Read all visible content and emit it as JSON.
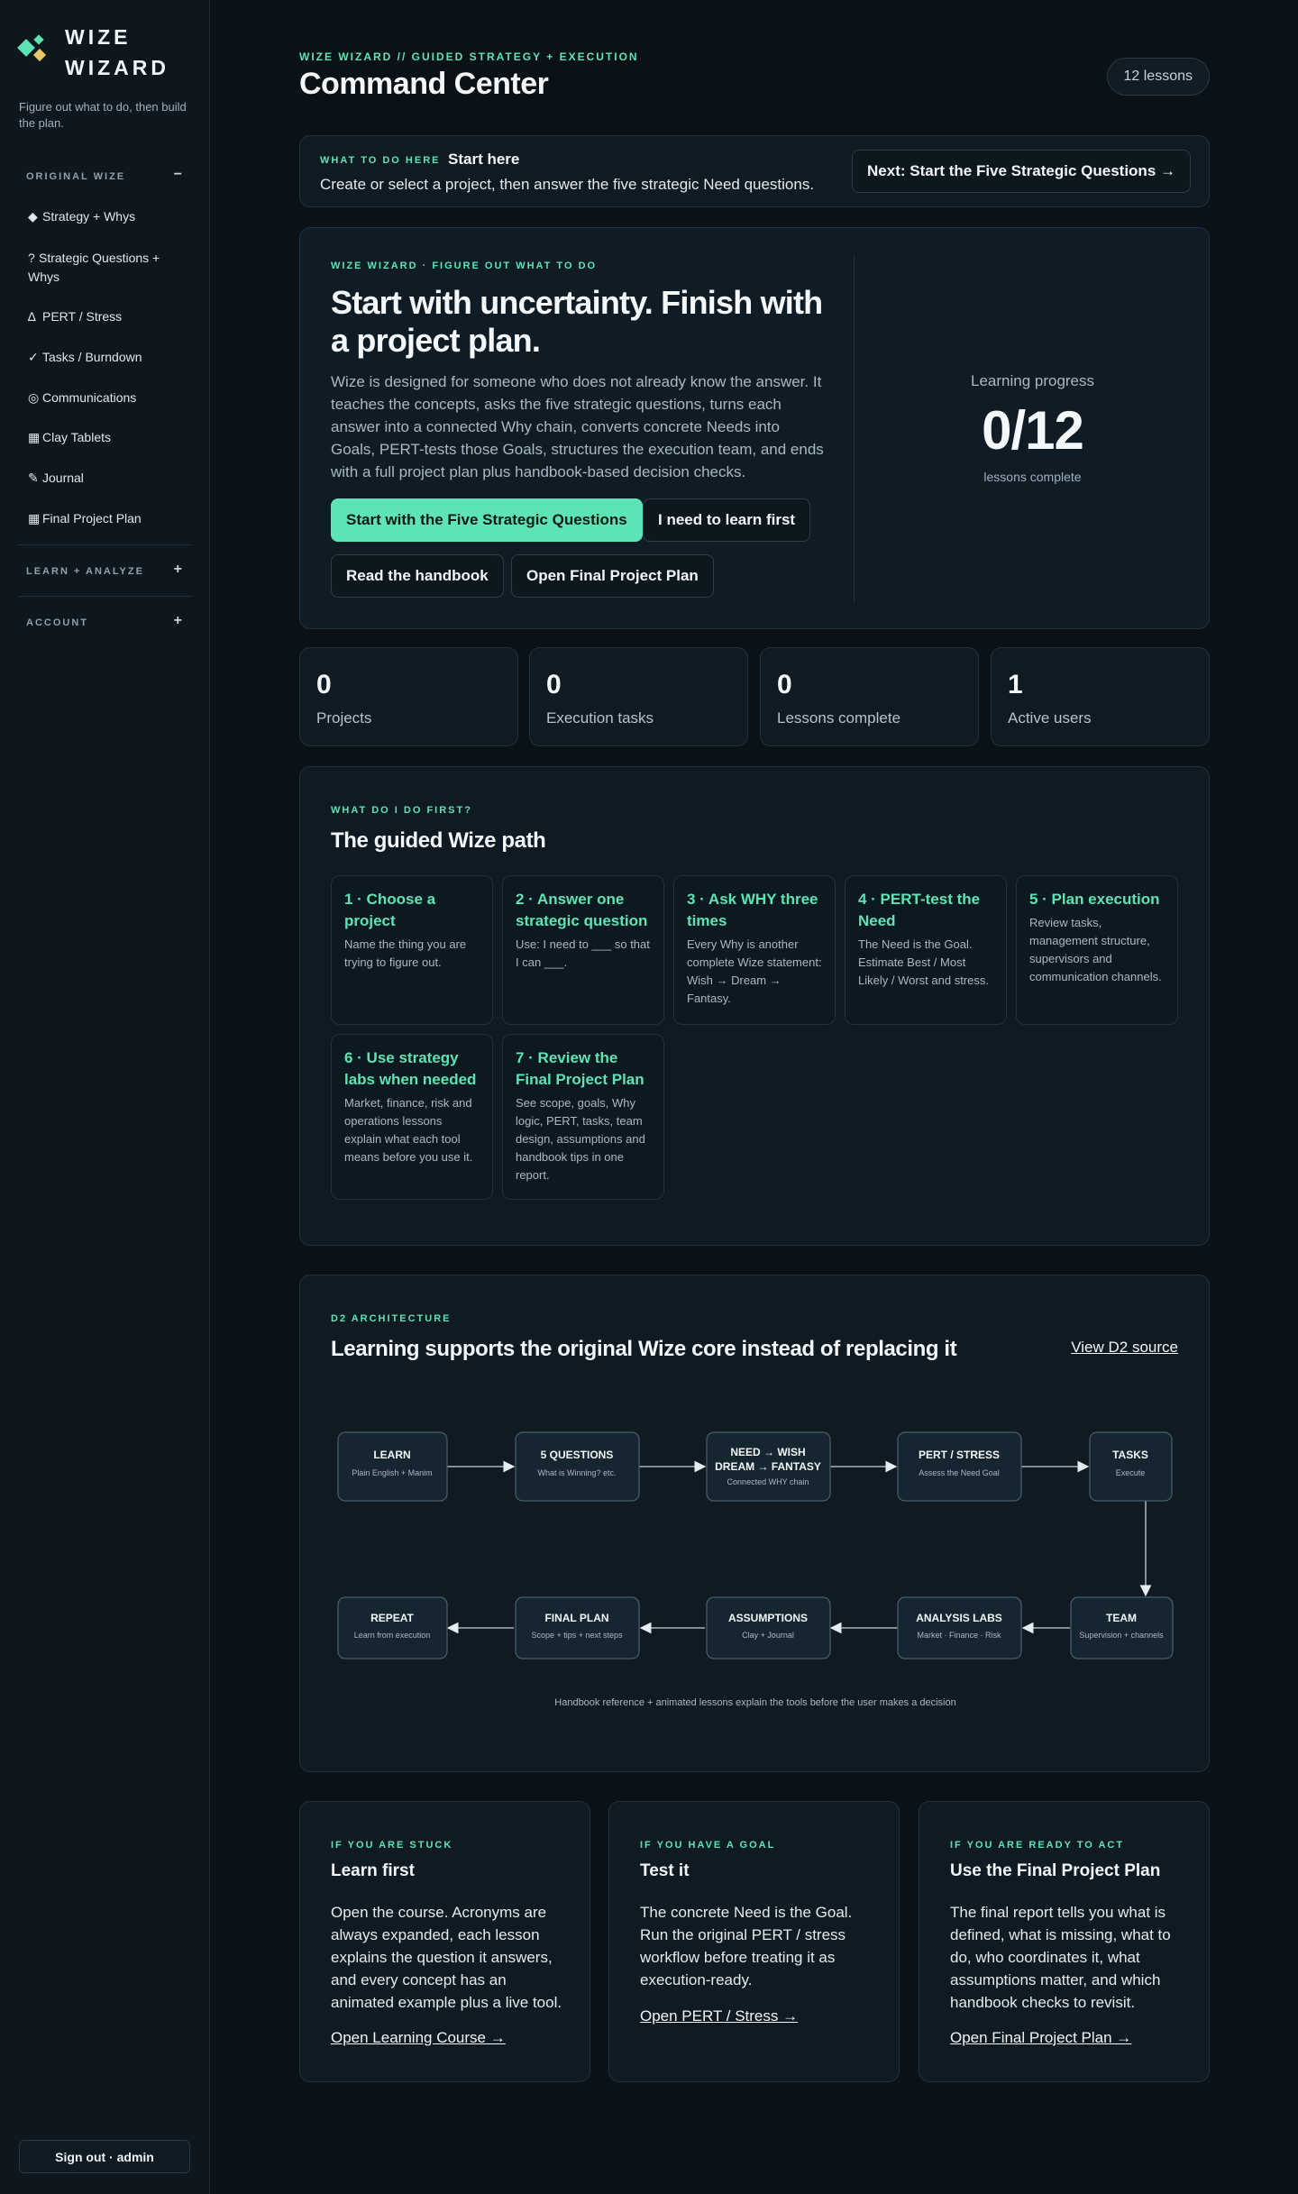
{
  "sidebar": {
    "brand_line1": "WIZE",
    "brand_line2": "WIZARD",
    "tagline": "Figure out what to do, then build the plan.",
    "sections": [
      {
        "label": "ORIGINAL WIZE",
        "toggle": "−"
      },
      {
        "label": "LEARN + ANALYZE",
        "toggle": "+"
      },
      {
        "label": "ACCOUNT",
        "toggle": "+"
      }
    ],
    "items": [
      {
        "glyph": "◆",
        "label": "Strategy + Whys",
        "icon": "diamond-icon"
      },
      {
        "glyph": "?",
        "label": "Strategic Questions + Whys",
        "icon": "question-icon"
      },
      {
        "glyph": "∆",
        "label": "PERT / Stress",
        "icon": "delta-icon"
      },
      {
        "glyph": "✓",
        "label": "Tasks / Burndown",
        "icon": "check-icon"
      },
      {
        "glyph": "◎",
        "label": "Communications",
        "icon": "target-icon"
      },
      {
        "glyph": "▦",
        "label": "Clay Tablets",
        "icon": "grid-icon"
      },
      {
        "glyph": "✎",
        "label": "Journal",
        "icon": "pencil-icon"
      },
      {
        "glyph": "▦",
        "label": "Final Project Plan",
        "icon": "grid-icon"
      }
    ],
    "signout_label": "Sign out · admin"
  },
  "header": {
    "eyebrow": "WIZE WIZARD // GUIDED STRATEGY + EXECUTION",
    "title": "Command Center",
    "lesson_count": "12 lessons"
  },
  "todo": {
    "eyebrow": "WHAT TO DO HERE",
    "title": "Start here",
    "description": "Create or select a project, then answer the five strategic Need questions.",
    "next_label": "Next: Start the Five Strategic Questions →"
  },
  "hero": {
    "eyebrow": "WIZE WIZARD · FIGURE OUT WHAT TO DO",
    "title": "Start with uncertainty. Finish with a project plan.",
    "description": "Wize is designed for someone who does not already know the answer. It teaches the concepts, asks the five strategic questions, turns each answer into a connected Why chain, converts concrete Needs into Goals, PERT-tests those Goals, structures the execution team, and ends with a full project plan plus handbook-based decision checks.",
    "buttons": {
      "start": "Start with the Five Strategic Questions",
      "learn": "I need to learn first",
      "handbook": "Read the handbook",
      "final_plan": "Open Final Project Plan"
    },
    "progress": {
      "label": "Learning progress",
      "value": "0/12",
      "sub": "lessons complete",
      "completed": 0,
      "total": 12
    }
  },
  "stats": [
    {
      "value": "0",
      "label": "Projects"
    },
    {
      "value": "0",
      "label": "Execution tasks"
    },
    {
      "value": "0",
      "label": "Lessons complete"
    },
    {
      "value": "1",
      "label": "Active users"
    }
  ],
  "path": {
    "eyebrow": "WHAT DO I DO FIRST?",
    "title": "The guided Wize path",
    "steps": [
      {
        "title": "1 · Choose a project",
        "desc": "Name the thing you are trying to figure out."
      },
      {
        "title": "2 · Answer one strategic question",
        "desc": "Use: I need to ___ so that I can ___."
      },
      {
        "title": "3 · Ask WHY three times",
        "desc": "Every Why is another complete Wize statement: Wish → Dream → Fantasy."
      },
      {
        "title": "4 · PERT-test the Need",
        "desc": "The Need is the Goal. Estimate Best / Most Likely / Worst and stress."
      },
      {
        "title": "5 · Plan execution",
        "desc": "Review tasks, management structure, supervisors and communication channels."
      },
      {
        "title": "6 · Use strategy labs when needed",
        "desc": "Market, finance, risk and operations lessons explain what each tool means before you use it."
      },
      {
        "title": "7 · Review the Final Project Plan",
        "desc": "See scope, goals, Why logic, PERT, tasks, team design, assumptions and handbook tips in one report."
      }
    ]
  },
  "architecture": {
    "eyebrow": "D2 ARCHITECTURE",
    "title": "Learning supports the original Wize core instead of replacing it",
    "link": "View D2 source",
    "caption": "Handbook reference + animated lessons explain the tools before the user makes a decision",
    "nodes": [
      {
        "id": "learn",
        "title": "LEARN",
        "sub": "Plain English + Manim"
      },
      {
        "id": "questions",
        "title": "5 QUESTIONS",
        "sub": "What is Winning? etc."
      },
      {
        "id": "need",
        "title": "NEED → WISH",
        "title2": "DREAM → FANTASY",
        "sub": "Connected WHY chain"
      },
      {
        "id": "pert",
        "title": "PERT / STRESS",
        "sub": "Assess the Need Goal"
      },
      {
        "id": "tasks",
        "title": "TASKS",
        "sub": "Execute"
      },
      {
        "id": "team",
        "title": "TEAM",
        "sub": "Supervision + channels"
      },
      {
        "id": "labs",
        "title": "ANALYSIS LABS",
        "sub": "Market · Finance · Risk"
      },
      {
        "id": "assumptions",
        "title": "ASSUMPTIONS",
        "sub": "Clay + Journal"
      },
      {
        "id": "final",
        "title": "FINAL PLAN",
        "sub": "Scope + tips + next steps"
      },
      {
        "id": "repeat",
        "title": "REPEAT",
        "sub": "Learn from execution"
      }
    ]
  },
  "tips": [
    {
      "eyebrow": "IF YOU ARE STUCK",
      "title": "Learn first",
      "desc": "Open the course. Acronyms are always expanded, each lesson explains the question it answers, and every concept has an animated example plus a live tool.",
      "link": "Open Learning Course →"
    },
    {
      "eyebrow": "IF YOU HAVE A GOAL",
      "title": "Test it",
      "desc": "The concrete Need is the Goal. Run the original PERT / stress workflow before treating it as execution-ready.",
      "link": "Open PERT / Stress →"
    },
    {
      "eyebrow": "IF YOU ARE READY TO ACT",
      "title": "Use the Final Project Plan",
      "desc": "The final report tells you what is defined, what is missing, what to do, who coordinates it, what assumptions matter, and which handbook checks to revisit.",
      "link": "Open Final Project Plan →"
    }
  ],
  "colors": {
    "accent": "#5ee3b4",
    "background": "#0a1117",
    "card": "#0f1a22",
    "border": "#22323d"
  }
}
